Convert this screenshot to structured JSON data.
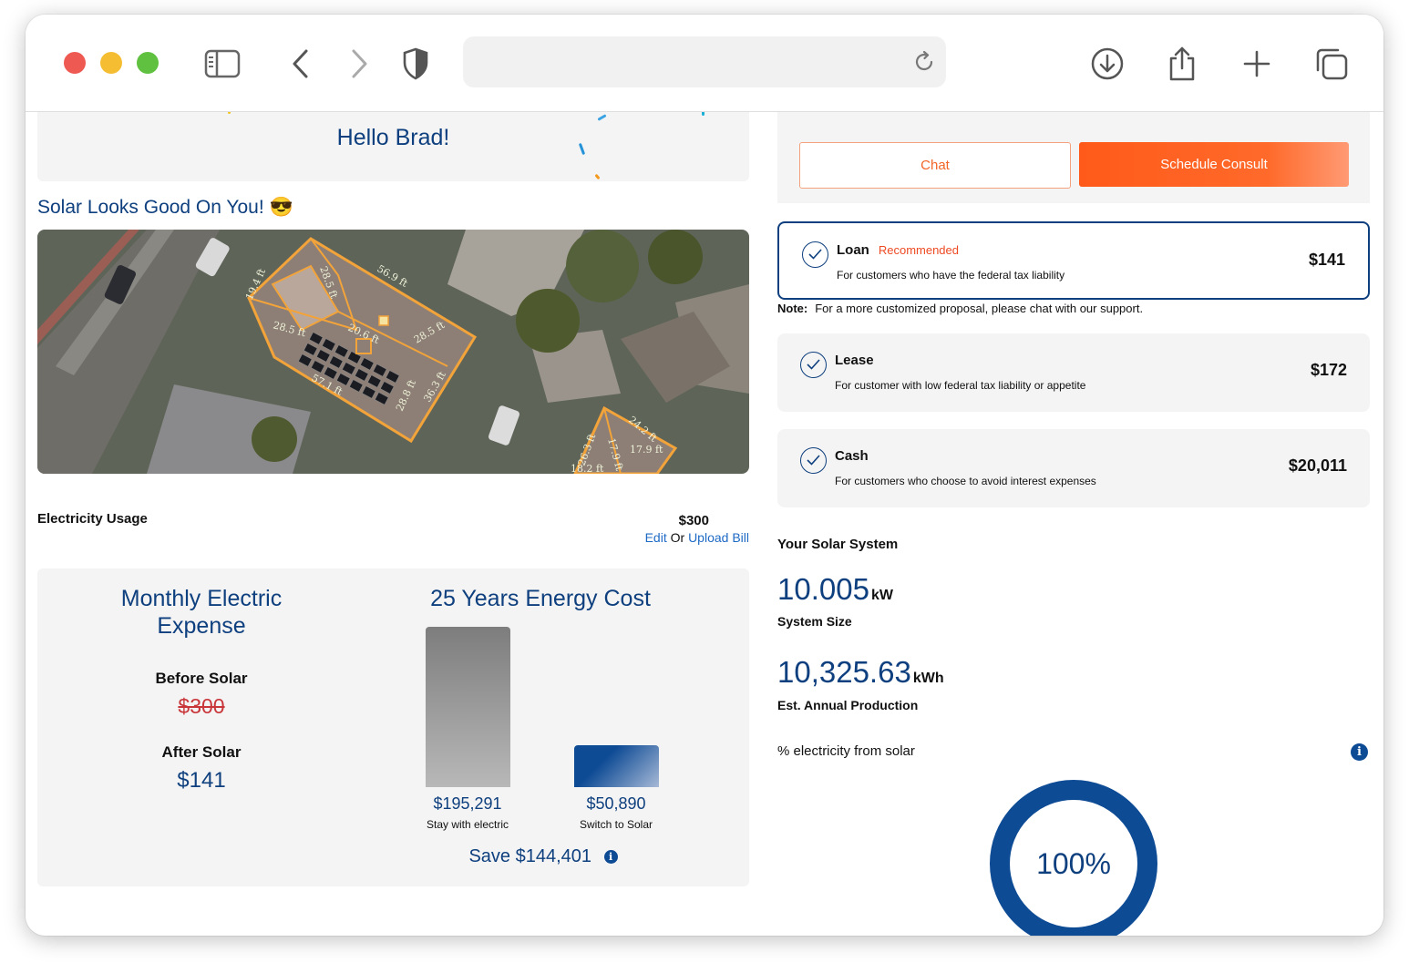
{
  "browser": {
    "address": ""
  },
  "greeting": "Hello Brad!",
  "subtitle": "Solar Looks Good On You! 😎",
  "roof_labels": [
    "19.4 ft",
    "28.5 ft",
    "56.9 ft",
    "28.5 ft",
    "20.6 ft",
    "28.5 ft",
    "57.1 ft",
    "28.8 ft",
    "36.3 ft",
    "24.2 ft",
    "17.9 ft",
    "17.9 ft",
    "26.3 ft",
    "18.2 ft"
  ],
  "usage": {
    "label": "Electricity Usage",
    "value": "$300",
    "edit": "Edit",
    "or": "Or",
    "upload": "Upload Bill"
  },
  "expense": {
    "heading": "Monthly Electric Expense",
    "before_label": "Before Solar",
    "before_value": "$300",
    "after_label": "After Solar",
    "after_value": "$141"
  },
  "energy_cost": {
    "heading": "25 Years Energy Cost",
    "stay_value": "$195,291",
    "stay_label": "Stay with electric",
    "switch_value": "$50,890",
    "switch_label": "Switch to Solar",
    "save": "Save $144,401",
    "values": [
      195291,
      50890
    ]
  },
  "actions": {
    "chat": "Chat",
    "consult": "Schedule Consult"
  },
  "plans": [
    {
      "title": "Loan",
      "tag": "Recommended",
      "desc": "For customers who have the federal tax liability",
      "price": "$141"
    },
    {
      "title": "Lease",
      "tag": "",
      "desc": "For customer with low federal tax liability or appetite",
      "price": "$172"
    },
    {
      "title": "Cash",
      "tag": "",
      "desc": "For customers who choose to avoid interest expenses",
      "price": "$20,011"
    }
  ],
  "note": {
    "label": "Note:",
    "text": "For a more customized proposal, please chat with our support."
  },
  "system": {
    "title": "Your Solar System",
    "size_value": "10.005",
    "size_unit": "kW",
    "size_label": "System Size",
    "prod_value": "10,325.63",
    "prod_unit": "kWh",
    "prod_label": "Est. Annual Production",
    "pct_label": "% electricity from solar",
    "pct_value": "100%",
    "pct_fraction": 1.0
  },
  "colors": {
    "brand_blue": "#0e3f7e",
    "accent_orange": "#ff5a1a",
    "strike_red": "#c9363a"
  }
}
